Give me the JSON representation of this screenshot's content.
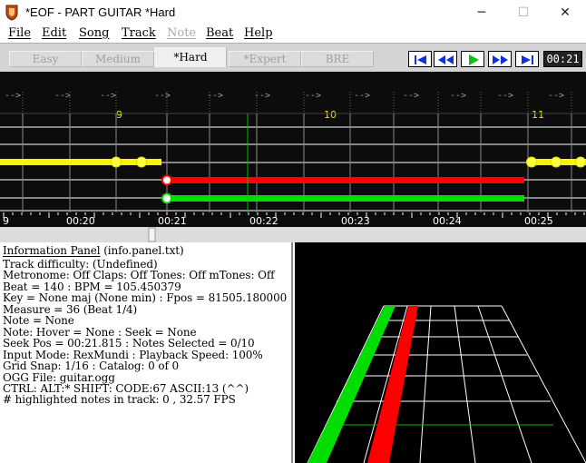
{
  "window": {
    "title": "*EOF - PART GUITAR  *Hard",
    "minimize_glyph": "─",
    "maximize_glyph": "☐",
    "close_glyph": "✕"
  },
  "menu": [
    "File",
    "Edit",
    "Song",
    "Track",
    "Note",
    "Beat",
    "Help"
  ],
  "difficulty_tabs": [
    {
      "label": "Easy",
      "active": false
    },
    {
      "label": "Medium",
      "active": false
    },
    {
      "label": "*Hard",
      "active": true
    },
    {
      "label": "*Expert",
      "active": false
    },
    {
      "label": "BRE",
      "active": false
    }
  ],
  "transport": {
    "buttons": [
      "seek-start",
      "rewind",
      "play",
      "fast-forward",
      "seek-end"
    ],
    "time": "00:21"
  },
  "timeline": {
    "measure_labels": [
      "9",
      "10",
      "11"
    ],
    "time_labels": [
      "00:20",
      "00:21",
      "00:22",
      "00:23",
      "00:24",
      "00:25"
    ],
    "left_edge_label": "9",
    "beat_marker_glyph": "-->"
  },
  "info_panel": {
    "title": "Information Panel",
    "title_suffix": " (info.panel.txt)",
    "lines": [
      "Track difficulty: (Undefined)",
      "Metronome: Off Claps: Off Tones: Off mTones: Off",
      "Beat = 140 : BPM = 105.450379",
      "Key = None maj (None min) : Fpos = 81505.180000",
      "Measure = 36 (Beat 1/4)",
      "Note = None",
      "Note: Hover = None : Seek = None",
      "Seek Pos = 00:21.815 : Notes Selected = 0/10",
      "Input Mode: RexMundi : Playback Speed: 100%",
      "Grid Snap: 1/16 : Catalog: 0 of 0",
      "OGG File: guitar.ogg",
      "CTRL:   ALT:* SHIFT:   CODE:67 ASCII:13 (^^)",
      "# highlighted notes in track: 0 , 32.57 FPS"
    ]
  },
  "colors": {
    "lane_yellow": "#f5f500",
    "lane_red": "#ff0000",
    "lane_green": "#00dd00",
    "measure_label": "#f0e000",
    "editor_bg": "#0c0c0c"
  }
}
